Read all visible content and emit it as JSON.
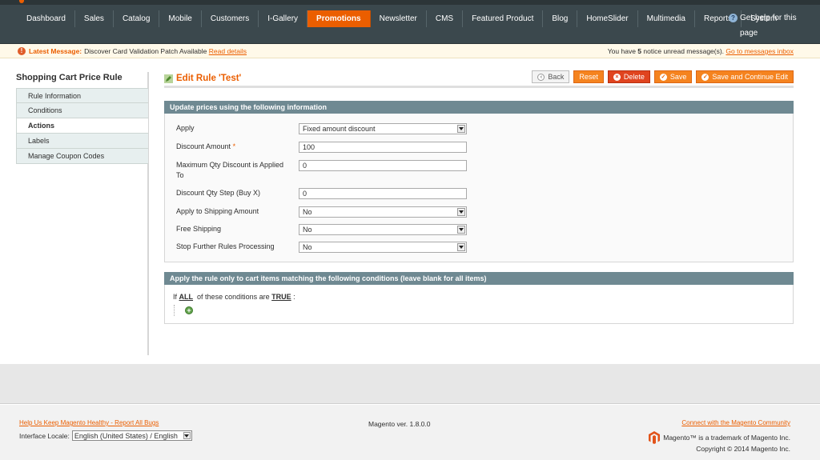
{
  "nav": {
    "items": [
      {
        "label": "Dashboard",
        "active": false
      },
      {
        "label": "Sales",
        "active": false
      },
      {
        "label": "Catalog",
        "active": false
      },
      {
        "label": "Mobile",
        "active": false
      },
      {
        "label": "Customers",
        "active": false
      },
      {
        "label": "I-Gallery",
        "active": false
      },
      {
        "label": "Promotions",
        "active": true
      },
      {
        "label": "Newsletter",
        "active": false
      },
      {
        "label": "CMS",
        "active": false
      },
      {
        "label": "Featured Product",
        "active": false
      },
      {
        "label": "Blog",
        "active": false
      },
      {
        "label": "HomeSlider",
        "active": false
      },
      {
        "label": "Multimedia",
        "active": false
      },
      {
        "label": "Reports",
        "active": false
      },
      {
        "label": "System",
        "active": false
      }
    ],
    "help": "Get help for this page"
  },
  "message": {
    "label": "Latest Message:",
    "text": "Discover Card Validation Patch Available",
    "link": "Read details",
    "right_prefix": "You have",
    "count": "5",
    "right_suffix": "notice unread message(s).",
    "right_link": "Go to messages inbox"
  },
  "sidebar": {
    "title": "Shopping Cart Price Rule",
    "tabs": [
      {
        "label": "Rule Information",
        "active": false
      },
      {
        "label": "Conditions",
        "active": false
      },
      {
        "label": "Actions",
        "active": true
      },
      {
        "label": "Labels",
        "active": false
      },
      {
        "label": "Manage Coupon Codes",
        "active": false
      }
    ]
  },
  "header": {
    "title": "Edit Rule 'Test'",
    "buttons": {
      "back": "Back",
      "reset": "Reset",
      "delete": "Delete",
      "save": "Save",
      "save_continue": "Save and Continue Edit"
    }
  },
  "actions": {
    "legend": "Update prices using the following information",
    "apply": {
      "label": "Apply",
      "value": "Fixed amount discount"
    },
    "discount_amount": {
      "label": "Discount Amount",
      "required": "*",
      "value": "100"
    },
    "max_qty": {
      "label": "Maximum Qty Discount is Applied To",
      "value": "0"
    },
    "qty_step": {
      "label": "Discount Qty Step (Buy X)",
      "value": "0"
    },
    "apply_shipping": {
      "label": "Apply to Shipping Amount",
      "value": "No"
    },
    "free_shipping": {
      "label": "Free Shipping",
      "value": "No"
    },
    "stop_rules": {
      "label": "Stop Further Rules Processing",
      "value": "No"
    }
  },
  "conditions": {
    "legend": "Apply the rule only to cart items matching the following conditions (leave blank for all items)",
    "prefix": "If",
    "aggregator": "ALL",
    "middle": "of these conditions are",
    "value": "TRUE",
    "suffix": ":"
  },
  "footer": {
    "bugs_link": "Help Us Keep Magento Healthy - Report All Bugs",
    "locale_label": "Interface Locale:",
    "locale_value": "English (United States) / English",
    "version": "Magento ver. 1.8.0.0",
    "community_link": "Connect with the Magento Community",
    "trademark": "Magento™ is a trademark of Magento Inc.",
    "copyright": "Copyright © 2014 Magento Inc."
  },
  "colors": {
    "accent": "#eb5e00",
    "nav_bg": "#3b484d",
    "fieldset_head": "#6f8992"
  }
}
